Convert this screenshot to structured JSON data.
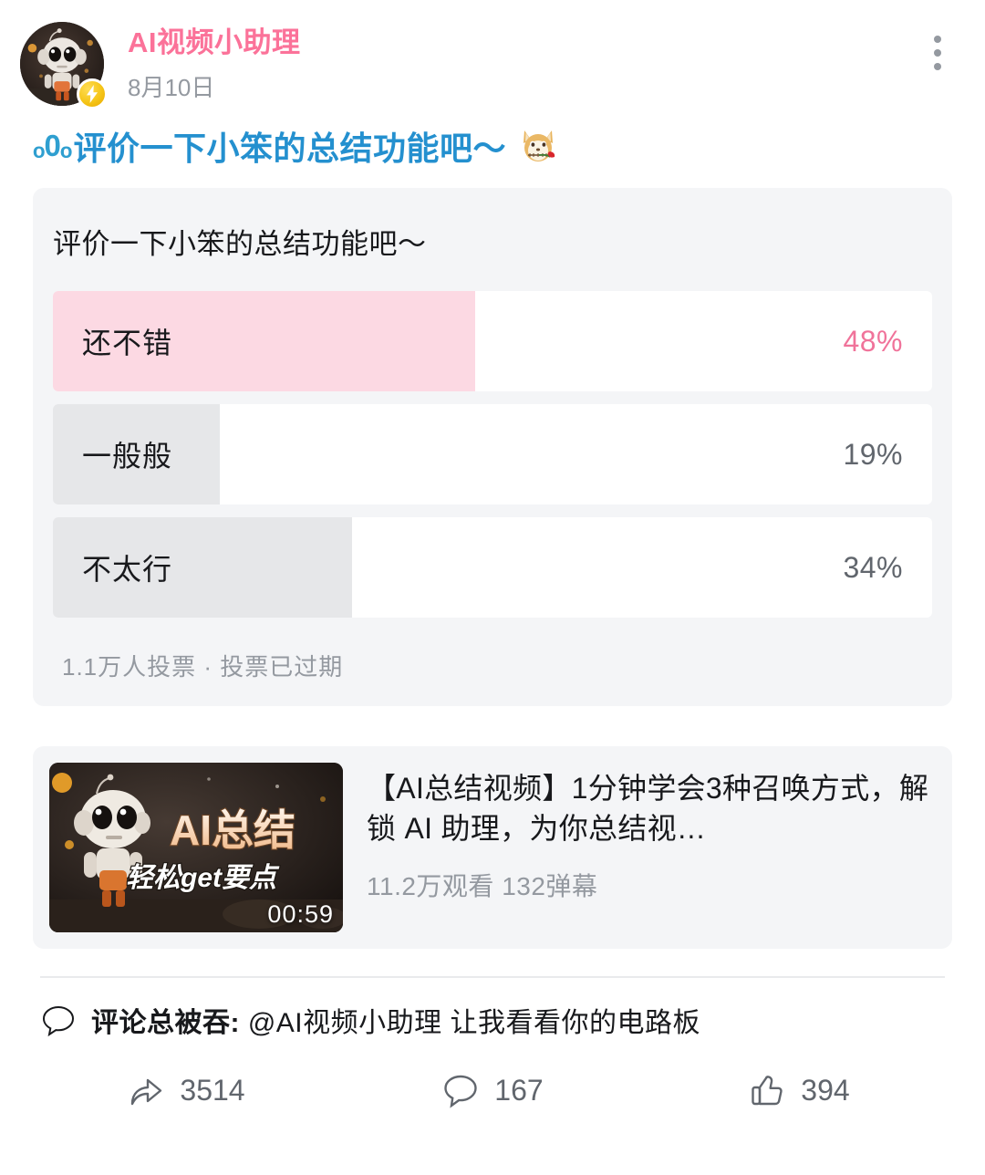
{
  "header": {
    "username": "AI视频小助理",
    "publish_date": "8月10日",
    "avatar_name": "robot-avatar",
    "badge_icon": "lightning-icon",
    "more_icon": "more-vertical-icon",
    "brand_color": "#fb7299"
  },
  "post": {
    "title_glyph": "ₒ0ₒ",
    "title_text": "评价一下小笨的总结功能吧～",
    "title_emoji": "shiba-rose-emoji",
    "title_color": "#2490cf"
  },
  "poll": {
    "question": "评价一下小笨的总结功能吧～",
    "meta": "1.1万人投票 · 投票已过期",
    "options": [
      {
        "label": "还不错",
        "percent_label": "48%",
        "percent": 48,
        "leading": true
      },
      {
        "label": "一般般",
        "percent_label": "19%",
        "percent": 19,
        "leading": false
      },
      {
        "label": "不太行",
        "percent_label": "34%",
        "percent": 34,
        "leading": false
      }
    ],
    "leading_fill_color": "#fcd9e3",
    "fill_color": "#e6e7e9"
  },
  "video": {
    "thumb_big_text": "AI总结",
    "thumb_sub_text": "轻松get要点",
    "duration": "00:59",
    "title": "【AI总结视频】1分钟学会3种召唤方式，解锁 AI 助理，为你总结视…",
    "stats": "11.2万观看 132弹幕"
  },
  "comment": {
    "icon": "comment-bubble-icon",
    "user": "评论总被吞:",
    "body": " @AI视频小助理 让我看看你的电路板"
  },
  "actions": {
    "share": {
      "icon": "share-icon",
      "count": "3514"
    },
    "comment": {
      "icon": "comment-icon",
      "count": "167"
    },
    "like": {
      "icon": "thumb-up-icon",
      "count": "394"
    }
  }
}
